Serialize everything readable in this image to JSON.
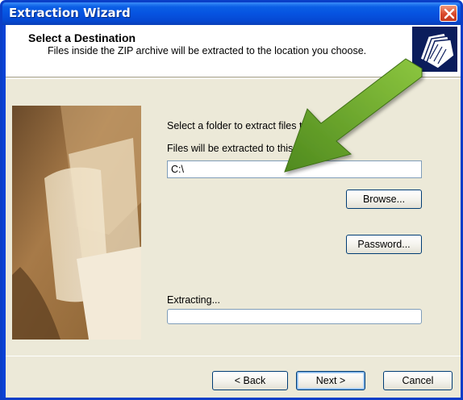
{
  "window": {
    "title": "Extraction Wizard"
  },
  "header": {
    "title": "Select a Destination",
    "subtitle": "Files inside the ZIP archive will be extracted to the location you choose.",
    "icon": "folders-icon"
  },
  "form": {
    "instruction": "Select a folder to extract files to.",
    "directory_label": "Files will be extracted to this directory:",
    "directory_value": "C:\\",
    "browse_label": "Browse...",
    "password_label": "Password...",
    "progress_label": "Extracting...",
    "progress_fraction": 0
  },
  "footer": {
    "back_label": "< Back",
    "next_label": "Next >",
    "cancel_label": "Cancel"
  },
  "colors": {
    "titlebar": "#0653e0",
    "dialog_bg": "#ece9d8",
    "arrow": "#6fa82e"
  }
}
